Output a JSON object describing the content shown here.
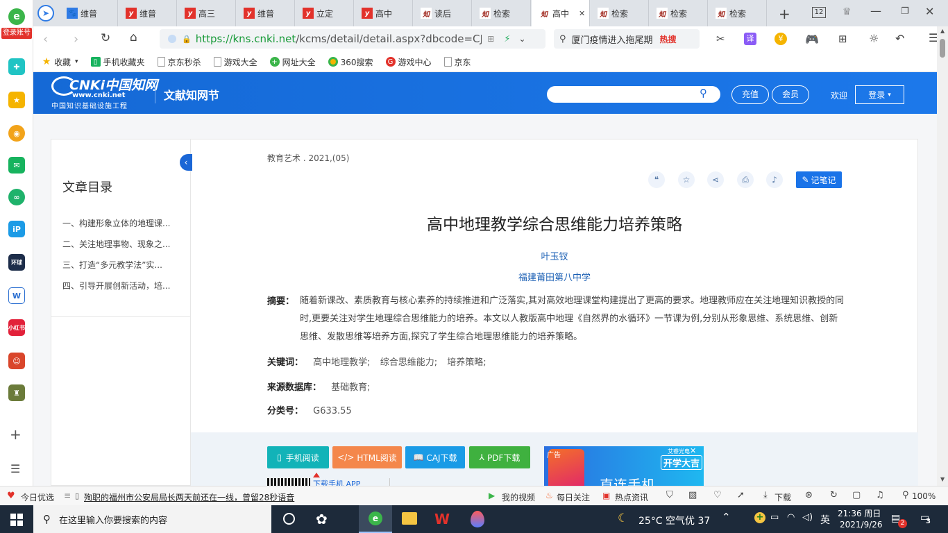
{
  "sidebar360": {
    "login_badge": "登录账号",
    "add_icon": "+",
    "menu_icon": "☰"
  },
  "tabs": [
    {
      "label": "维普",
      "icon": "paw-icon"
    },
    {
      "label": "维普",
      "icon": "y-icon"
    },
    {
      "label": "高三",
      "icon": "y-icon"
    },
    {
      "label": "维普",
      "icon": "y-icon"
    },
    {
      "label": "立定",
      "icon": "y-icon"
    },
    {
      "label": "高中",
      "icon": "y-icon"
    },
    {
      "label": "读后",
      "icon": "zhi-icon"
    },
    {
      "label": "检索",
      "icon": "zhi-icon"
    },
    {
      "label": "高中",
      "icon": "zhi-icon",
      "active": true
    },
    {
      "label": "检索",
      "icon": "zhi-icon"
    },
    {
      "label": "检索",
      "icon": "zhi-icon"
    },
    {
      "label": "检索",
      "icon": "zhi-icon"
    }
  ],
  "tab_count": "12",
  "address": {
    "url_host": "https://kns.cnki.net",
    "url_path": "/kcms/detail/detail.aspx?dbcode=CJFD&d",
    "search_text": "厦门疫情进入拖尾期",
    "hot_label": "热搜"
  },
  "bookmarks": [
    {
      "label": "收藏"
    },
    {
      "label": "手机收藏夹"
    },
    {
      "label": "京东秒杀"
    },
    {
      "label": "游戏大全"
    },
    {
      "label": "网址大全"
    },
    {
      "label": "360搜索"
    },
    {
      "label": "游戏中心"
    },
    {
      "label": "京东"
    }
  ],
  "cnki": {
    "logo_main": "CNKi中国知网",
    "logo_url": "www.cnki.net",
    "logo_sub": "中国知识基础设施工程",
    "section": "文献知网节",
    "recharge": "充值",
    "member": "会员",
    "welcome": "欢迎",
    "login": "登录"
  },
  "toc": {
    "title": "文章目录",
    "items": [
      "一、构建形象立体的地理课...",
      "二、关注地理事物、现象之...",
      "三、打造“多元教学法”实...",
      "四、引导开展创新活动，培..."
    ]
  },
  "article": {
    "source": "教育艺术 . 2021,(05)",
    "note_button": "记笔记",
    "title": "高中地理教学综合思维能力培养策略",
    "author": "叶玉钗",
    "affiliation": "福建莆田第八中学",
    "abstract_label": "摘要：",
    "abstract": "随着新课改、素质教育与核心素养的持续推进和广泛落实,其对高效地理课堂构建提出了更高的要求。地理教师应在关注地理知识教授的同时,更要关注对学生地理综合思维能力的培养。本文以人教版高中地理《自然界的水循环》一节课为例,分别从形象思维、系统思维、创新思维、发散思维等培养方面,探究了学生综合地理思维能力的培养策略。",
    "keywords_label": "关键词：",
    "keywords": [
      "高中地理教学;",
      "综合思维能力;",
      "培养策略;"
    ],
    "db_label": "来源数据库：",
    "db": "基础教育;",
    "class_label": "分类号：",
    "class": "G633.55"
  },
  "downloads": {
    "mobile": "手机阅读",
    "html": "HTML阅读",
    "caj": "CAJ下载",
    "pdf": "PDF下载",
    "app": "下载手机 APP",
    "ad_label": "广告",
    "ad_brand": "艾睿光电",
    "ad_promo": "开学大吉",
    "ad_text": "直连手机"
  },
  "statusbar": {
    "today": "今日优选",
    "news": "殉职的福州市公安局局长两天前还在一线，曾留28秒语音",
    "video": "我的视频",
    "daily": "每日关注",
    "hot": "热点资讯",
    "download": "下载",
    "zoom": "100%"
  },
  "taskbar": {
    "search_placeholder": "在这里输入你要搜索的内容",
    "weather": "25°C  空气优 37",
    "ime": "英",
    "time": "21:36 周日",
    "date": "2021/9/26",
    "notif_count": "2",
    "action_count": "3"
  }
}
